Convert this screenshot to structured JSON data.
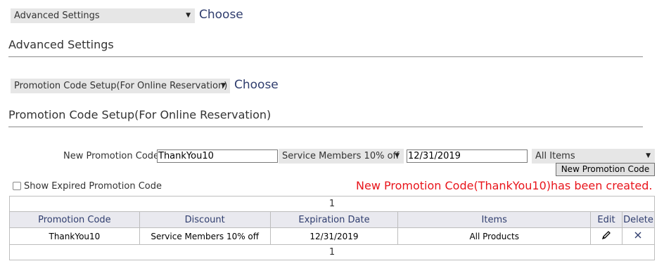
{
  "settings_select": {
    "value": "Advanced Settings",
    "choose_label": "Choose"
  },
  "advanced_title": "Advanced Settings",
  "promo_select": {
    "value": "Promotion Code Setup(For Online Reservation)",
    "choose_label": "Choose"
  },
  "promo_title": "Promotion Code Setup(For Online Reservation)",
  "new_promo": {
    "label": "New Promotion Code",
    "code_value": "ThankYou10",
    "discount_value": "Service Members 10% off",
    "date_value": "12/31/2019",
    "items_value": "All Items",
    "button_label": "New Promotion Code"
  },
  "show_expired_label": "Show Expired Promotion Code",
  "status_message": "New Promotion Code(ThankYou10)has been created.",
  "status_color": "#e8141b",
  "table": {
    "pager_top": "1",
    "pager_bottom": "1",
    "headers": [
      "Promotion Code",
      "Discount",
      "Expiration Date",
      "Items",
      "Edit",
      "Delete"
    ],
    "rows": [
      {
        "code": "ThankYou10",
        "discount": "Service Members 10% off",
        "expiration": "12/31/2019",
        "items": "All Products",
        "edit_icon": "pencil-icon",
        "delete_icon": "close-icon"
      }
    ]
  },
  "icons": {
    "dropdown": "triangle-down-icon",
    "edit": "pencil-icon",
    "delete": "close-icon"
  }
}
